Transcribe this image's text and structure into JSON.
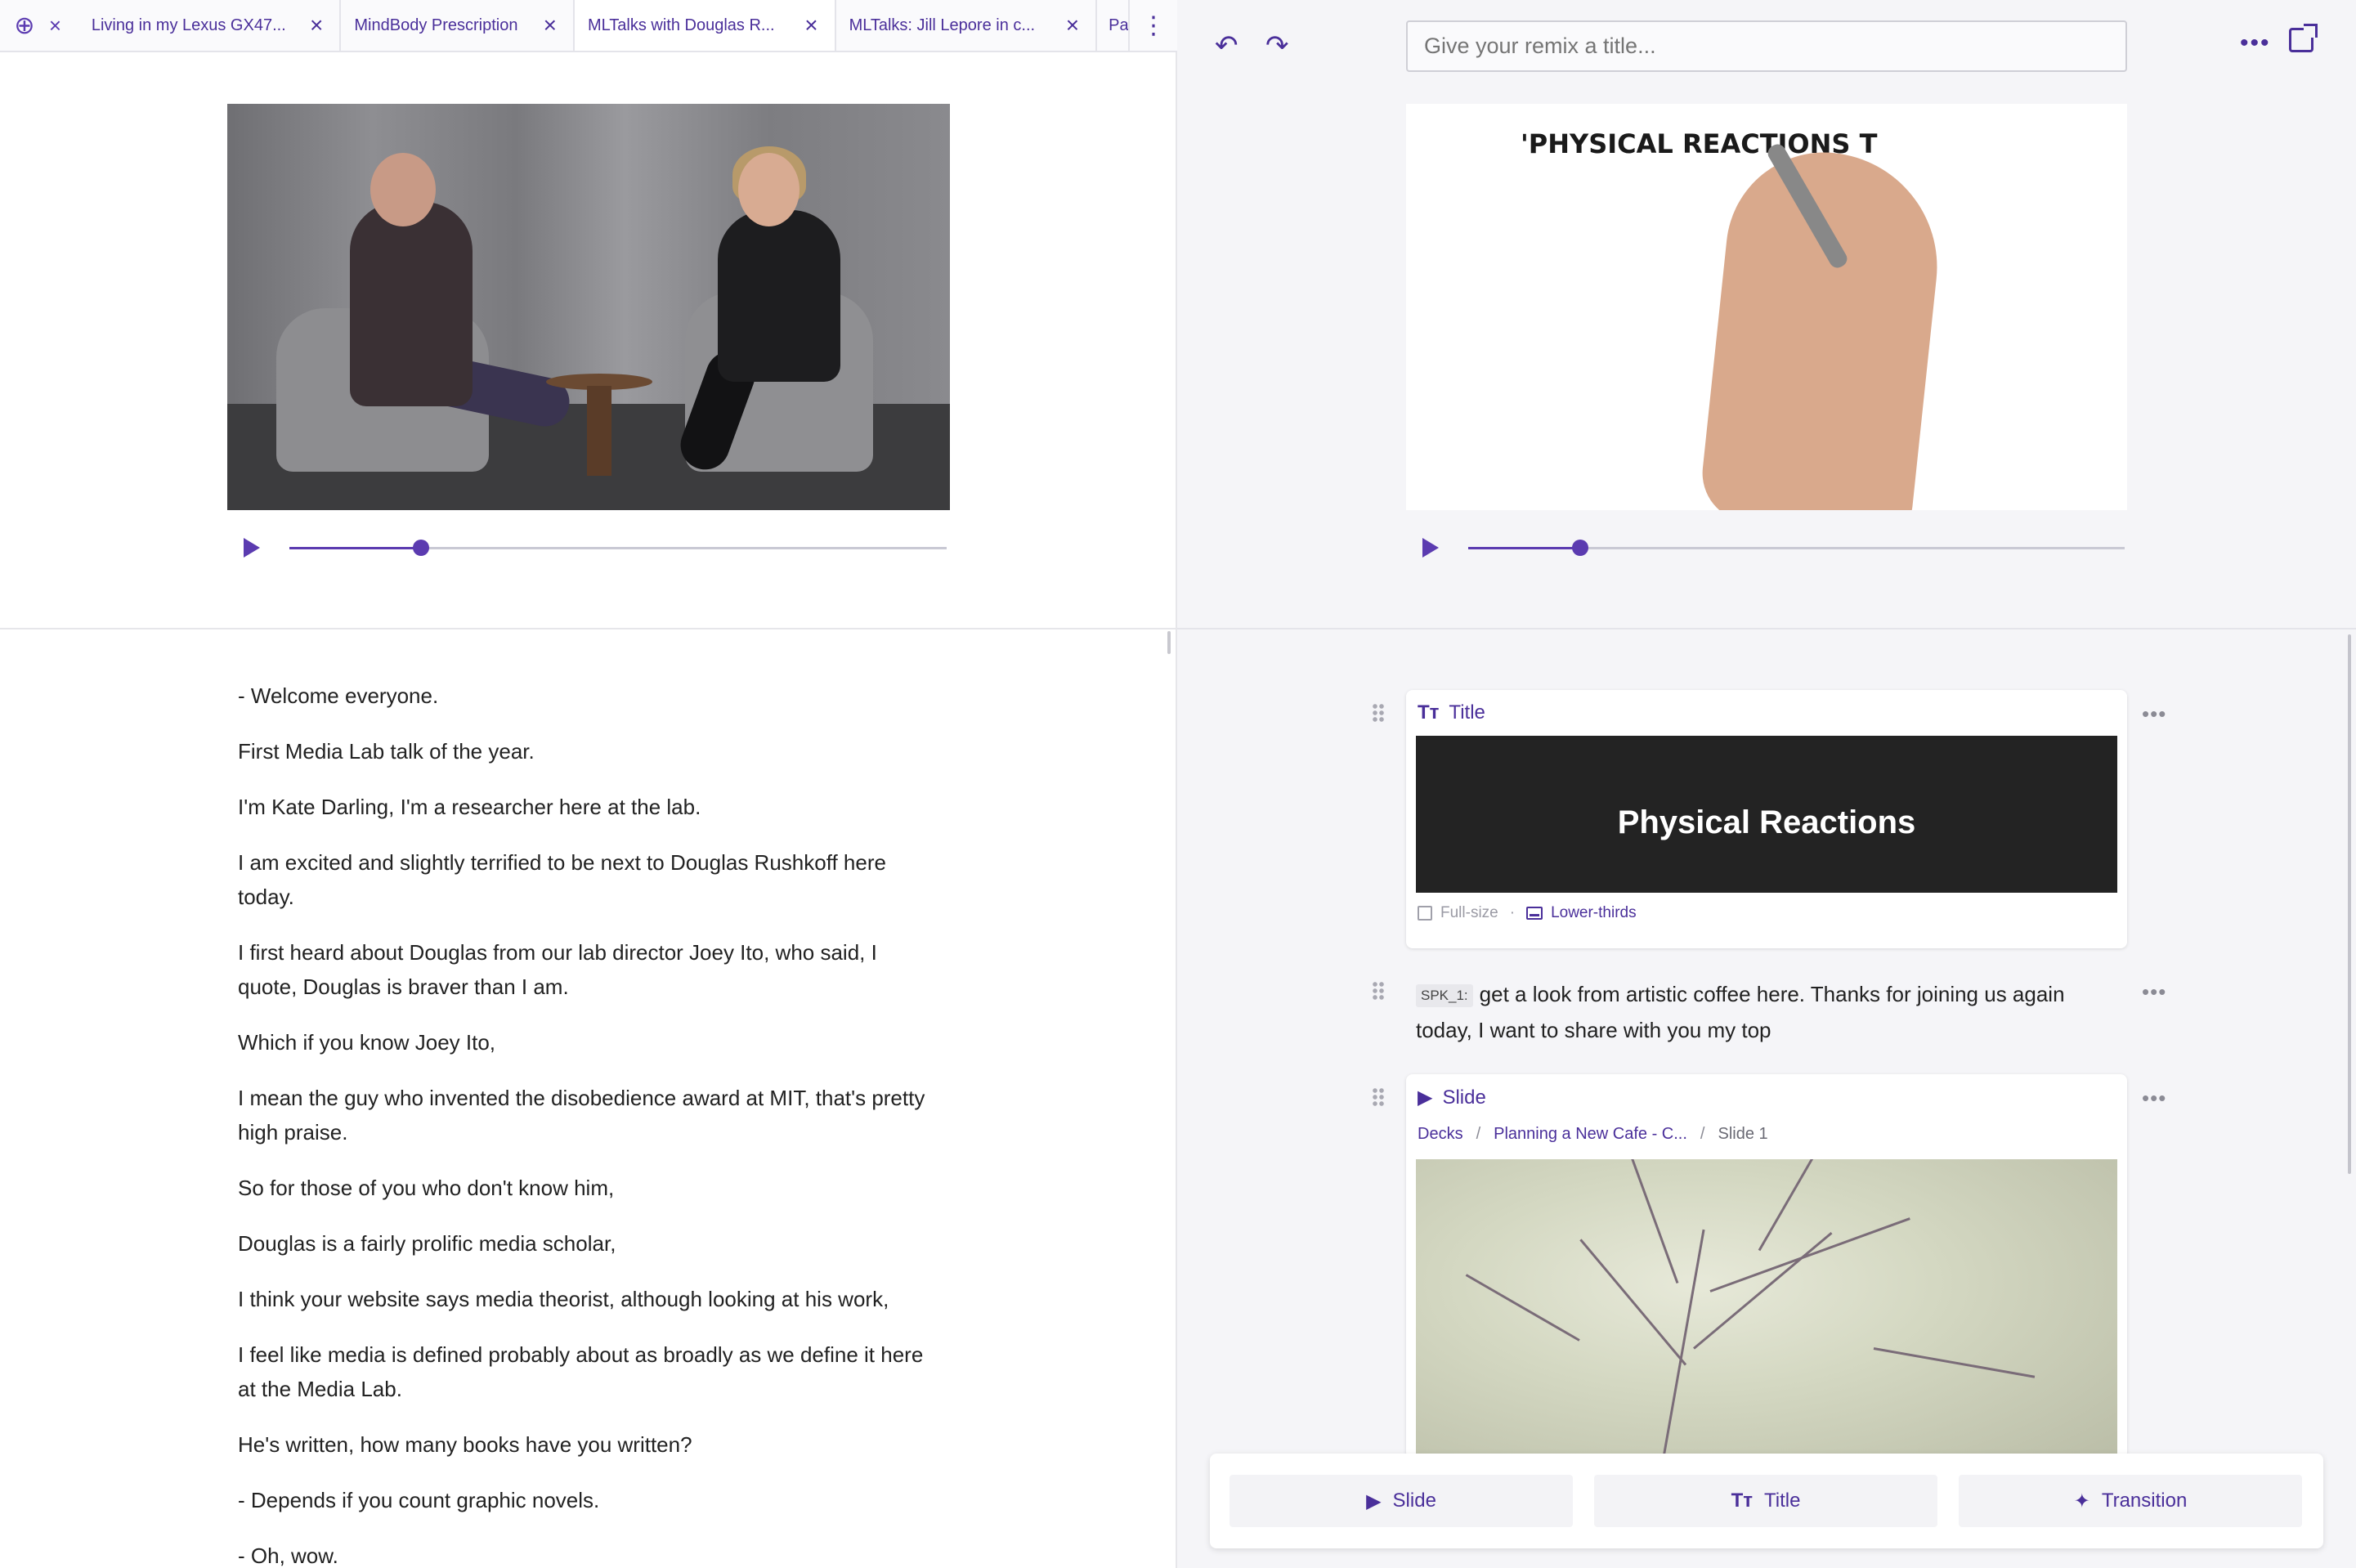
{
  "tabs": [
    {
      "label": "Living in my Lexus GX47...",
      "active": false
    },
    {
      "label": "MindBody Prescription",
      "active": false
    },
    {
      "label": "MLTalks with Douglas R...",
      "active": true
    },
    {
      "label": "MLTalks: Jill Lepore in c...",
      "active": false
    },
    {
      "label": "Pa",
      "active": false
    }
  ],
  "source_player": {
    "progress_percent": 20
  },
  "transcript": [
    "- Welcome everyone.",
    "First Media Lab talk of the year.",
    "I'm Kate Darling, I'm a researcher here at the lab.",
    "I am excited and slightly terrified to be next to Douglas Rushkoff here today.",
    "I first heard about Douglas from our lab director Joey Ito, who said, I quote, Douglas is braver than I am.",
    "Which if you know Joey Ito,",
    "I mean the guy who invented the disobedience award at MIT, that's pretty high praise.",
    "So for those of you who don't know him,",
    "Douglas is a fairly prolific media scholar,",
    "I think your website says media theorist, although looking at his work,",
    "I feel like media is defined probably about as broadly as we define it here at the Media Lab.",
    "He's written, how many books have you written?",
    "- Depends if you count graphic novels.",
    "- Oh, wow."
  ],
  "remix": {
    "title_placeholder": "Give your remix a title...",
    "preview_text": "'PHYSICAL REACTIONS T",
    "player": {
      "progress_percent": 17
    }
  },
  "cards": {
    "title_card": {
      "type_label": "Title",
      "title_text": "Physical Reactions",
      "full_size_label": "Full-size",
      "lower_thirds_label": "Lower-thirds"
    },
    "speech": {
      "speaker": "SPK_1:",
      "text": "get a look from artistic coffee here. Thanks for joining us again today, I want to share with you my top"
    },
    "slide_card": {
      "type_label": "Slide",
      "crumb_root": "Decks",
      "crumb_deck": "Planning a New Cafe - C...",
      "crumb_slide": "Slide 1"
    }
  },
  "add_bar": {
    "slide_label": "Slide",
    "title_label": "Title",
    "transition_label": "Transition"
  }
}
